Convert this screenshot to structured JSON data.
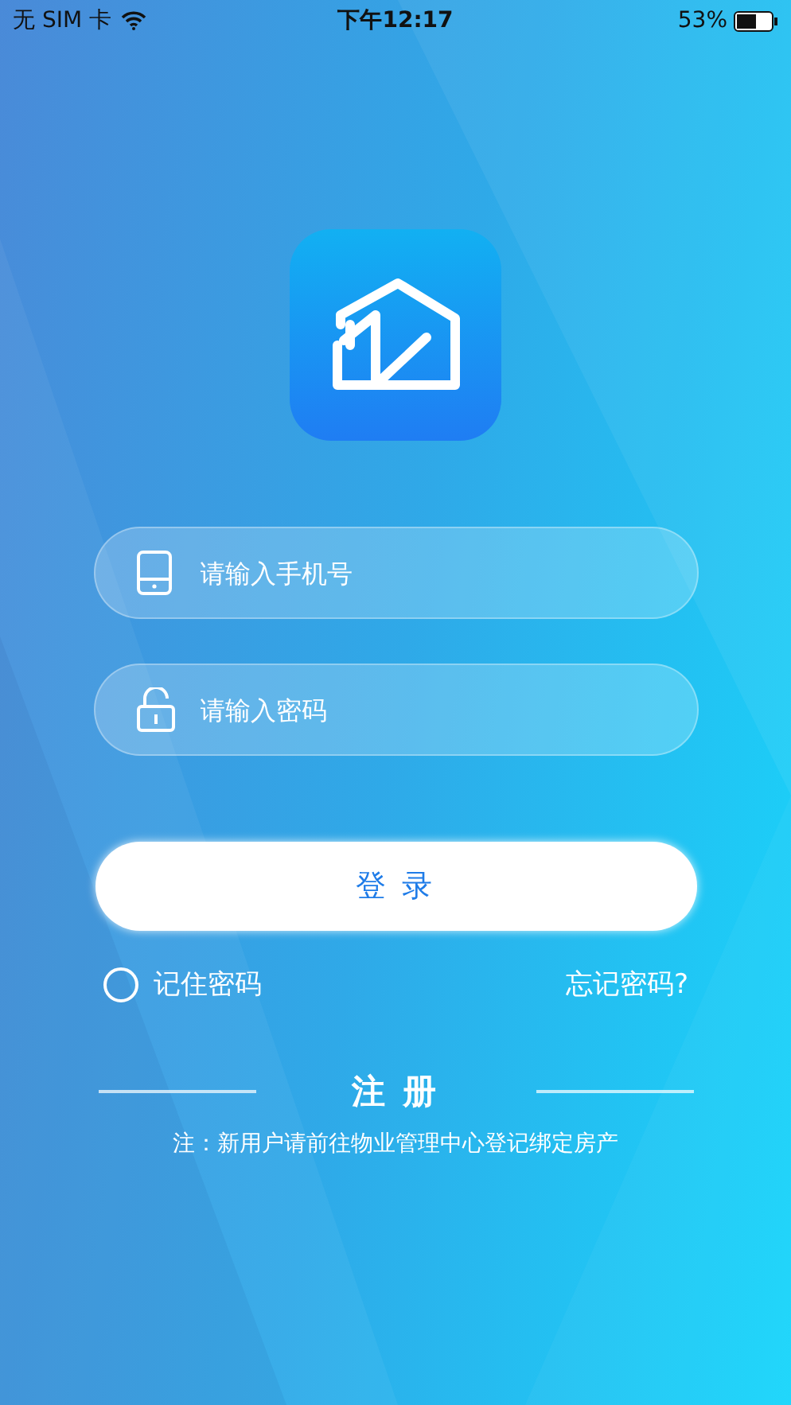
{
  "status_bar": {
    "carrier": "无 SIM 卡",
    "time": "下午12:17",
    "battery": "53%"
  },
  "fields": [
    {
      "kind": "phone",
      "placeholder": "请输入手机号"
    },
    {
      "kind": "password",
      "placeholder": "请输入密码"
    }
  ],
  "login_button": "登 录",
  "remember": {
    "label": "记住密码",
    "checked": false
  },
  "forgot_link": "忘记密码?",
  "register": "注 册",
  "note": "注：新用户请前往物业管理中心登记绑定房产"
}
